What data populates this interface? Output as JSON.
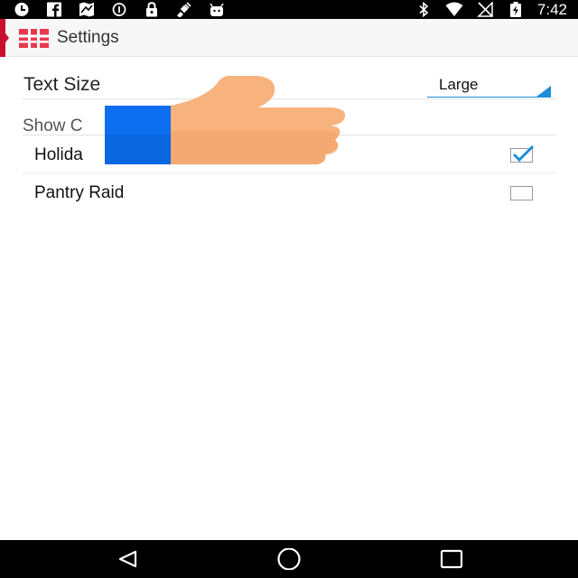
{
  "status_bar": {
    "time": "7:42",
    "left_icons": [
      "clock-icon",
      "facebook-icon",
      "maps-icon",
      "data-saver-icon",
      "lock-icon",
      "satellite-icon",
      "android-icon"
    ],
    "right_icons": [
      "bluetooth-icon",
      "wifi-icon",
      "no-signal-icon",
      "battery-charging-icon"
    ]
  },
  "action_bar": {
    "title": "Settings",
    "accent_color": "#c8102e",
    "app_icon": "app-logo-icon"
  },
  "preferences": {
    "text_size": {
      "label": "Text Size",
      "value": "Large"
    },
    "show_section": {
      "label": "Show C"
    },
    "items": [
      {
        "label": "Holida",
        "checked": true
      },
      {
        "label": "Pantry Raid",
        "checked": false
      }
    ]
  },
  "overlay": {
    "icon": "thumbs-up-icon",
    "cuff_color": "#0d6ff0",
    "hand_color": "#f7b27e"
  },
  "nav_bar": {
    "buttons": [
      "back-icon",
      "home-icon",
      "recents-icon"
    ]
  },
  "colors": {
    "accent": "#1f8ed8",
    "checkbox_check": "#1f8ed8"
  }
}
